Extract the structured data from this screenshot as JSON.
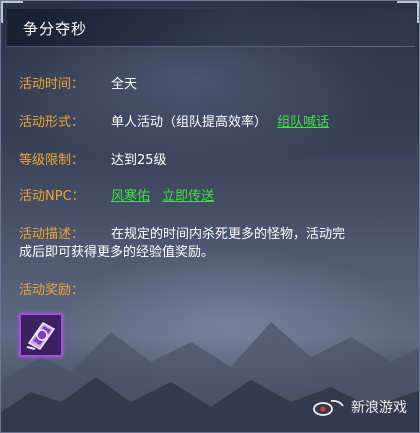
{
  "title": "争分夺秒",
  "rows": {
    "time": {
      "label": "活动时间：",
      "value": "全天"
    },
    "form": {
      "label": "活动形式：",
      "value": "单人活动（组队提高效率）",
      "link": "组队喊话"
    },
    "level": {
      "label": "等级限制：",
      "value": "达到25级"
    },
    "npc": {
      "label": "活动NPC：",
      "npc_name": "风寒佑",
      "teleport": "立即传送"
    },
    "desc": {
      "label": "活动描述：",
      "line1": "在规定的时间内杀死更多的怪物，活动完",
      "line2": "成后即可获得更多的经验值奖励。"
    },
    "reward": {
      "label": "活动奖励："
    }
  },
  "reward_item": {
    "icon": "purple-scroll-icon",
    "rarity_color": "#a24fe0"
  },
  "watermark": {
    "brand": "sina",
    "text": "新浪游戏"
  },
  "colors": {
    "label": "#f0a535",
    "value": "#ffffff",
    "link": "#41e046",
    "item_border": "#a24fe0"
  }
}
